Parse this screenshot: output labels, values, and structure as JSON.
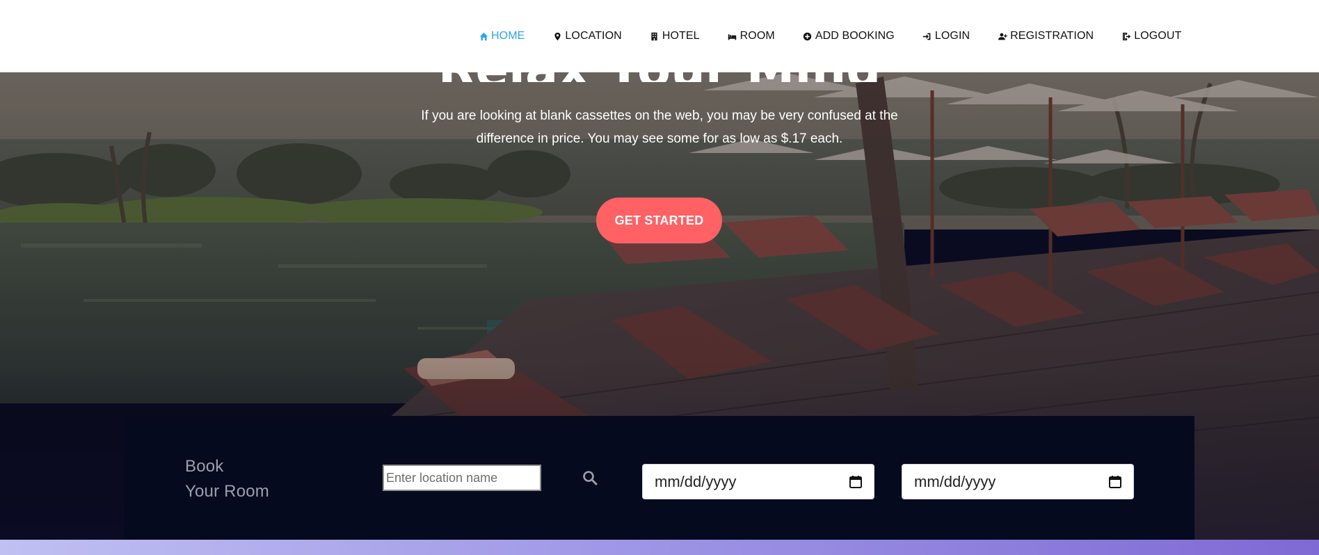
{
  "nav": {
    "items": [
      {
        "label": "HOME",
        "icon": "home-icon",
        "active": true
      },
      {
        "label": "LOCATION",
        "icon": "map-marker-icon",
        "active": false
      },
      {
        "label": "HOTEL",
        "icon": "building-icon",
        "active": false
      },
      {
        "label": "ROOM",
        "icon": "bed-icon",
        "active": false
      },
      {
        "label": "ADD BOOKING",
        "icon": "plus-circle-icon",
        "active": false
      },
      {
        "label": "LOGIN",
        "icon": "sign-in-icon",
        "active": false
      },
      {
        "label": "REGISTRATION",
        "icon": "user-plus-icon",
        "active": false
      },
      {
        "label": "LOGOUT",
        "icon": "sign-out-icon",
        "active": false
      }
    ],
    "active_color": "#2aa7e8"
  },
  "hero": {
    "title": "Relax Your Mind",
    "subtitle": "If you are looking at blank cassettes on the web, you may be very confused at the difference in price. You may see some for as low as $.17 each.",
    "cta_label": "GET STARTED",
    "cta_color": "#ff6165"
  },
  "booking": {
    "title_line1": "Book",
    "title_line2": "Your Room",
    "location_placeholder": "Enter location name",
    "search_icon": "search-icon",
    "checkin_placeholder": "mm/dd/yyyy",
    "checkout_placeholder": "mm/dd/yyyy",
    "calendar_icon": "calendar-icon"
  }
}
